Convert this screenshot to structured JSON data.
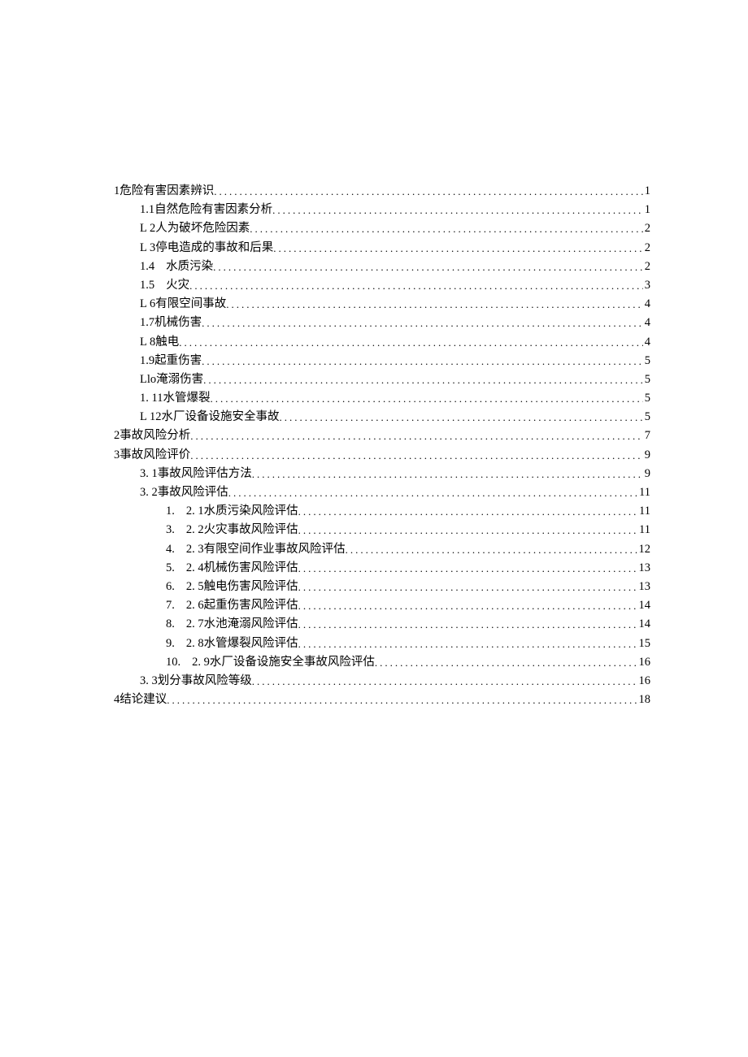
{
  "toc": [
    {
      "level": 0,
      "label": "1危险有害因素辨识",
      "page": "1"
    },
    {
      "level": 1,
      "label": "1.1自然危险有害因素分析",
      "page": " 1"
    },
    {
      "level": 1,
      "label": "L 2人为破坏危险因素",
      "page": "2"
    },
    {
      "level": 1,
      "label": "L 3停电造成的事故和后果",
      "page": "2"
    },
    {
      "level": 1,
      "num": "1.4",
      "label": "水质污染",
      "page": "2"
    },
    {
      "level": 1,
      "num": "1.5",
      "label": "火灾",
      "page": "3"
    },
    {
      "level": 1,
      "label": "L 6有限空间事故",
      "page": "4"
    },
    {
      "level": 1,
      "label": "1.7机械伤害",
      "page": "4"
    },
    {
      "level": 1,
      "label": "L 8触电",
      "page": "4"
    },
    {
      "level": 1,
      "label": "1.9起重伤害",
      "page": "5"
    },
    {
      "level": 1,
      "label": "Llo淹溺伤害",
      "page": "5"
    },
    {
      "level": 1,
      "label": "1.  11水管爆裂",
      "page": "5"
    },
    {
      "level": 1,
      "label": "L 12水厂设备设施安全事故",
      "page": "5"
    },
    {
      "level": 0,
      "label": "2事故风险分析",
      "page": "7"
    },
    {
      "level": 0,
      "label": "3事故风险评价",
      "page": "9"
    },
    {
      "level": 1,
      "label": "3. 1事故风险评估方法 ",
      "page": "9"
    },
    {
      "level": 1,
      "label": "3.  2事故风险评估 ",
      "page": "11"
    },
    {
      "level": 2,
      "num": "1.",
      "label": "2. 1水质污染风险评估 ",
      "page": "11"
    },
    {
      "level": 2,
      "num": "3.",
      "label": "2. 2火灾事故风险评估 ",
      "page": "11"
    },
    {
      "level": 2,
      "num": "4.",
      "label": "2. 3有限空间作业事故风险评估 ",
      "page": "12"
    },
    {
      "level": 2,
      "num": "5.",
      "label": "2. 4机械伤害风险评估 ",
      "page": "13"
    },
    {
      "level": 2,
      "num": "6.",
      "label": "2. 5触电伤害风险评估 ",
      "page": "13"
    },
    {
      "level": 2,
      "num": "7.",
      "label": "2. 6起重伤害风险评估 ",
      "page": "14"
    },
    {
      "level": 2,
      "num": "8.",
      "label": "2. 7水池淹溺风险评估 ",
      "page": "14"
    },
    {
      "level": 2,
      "num": "9.",
      "label": "2. 8水管爆裂风险评估 ",
      "page": "15"
    },
    {
      "level": 2,
      "num": "10.",
      "label": "2. 9水厂设备设施安全事故风险评估 ",
      "page": "16"
    },
    {
      "level": 1,
      "label": "3. 3划分事故风险等级 ",
      "page": "16"
    },
    {
      "level": 0,
      "label": "4结论建议",
      "page": "18"
    }
  ]
}
